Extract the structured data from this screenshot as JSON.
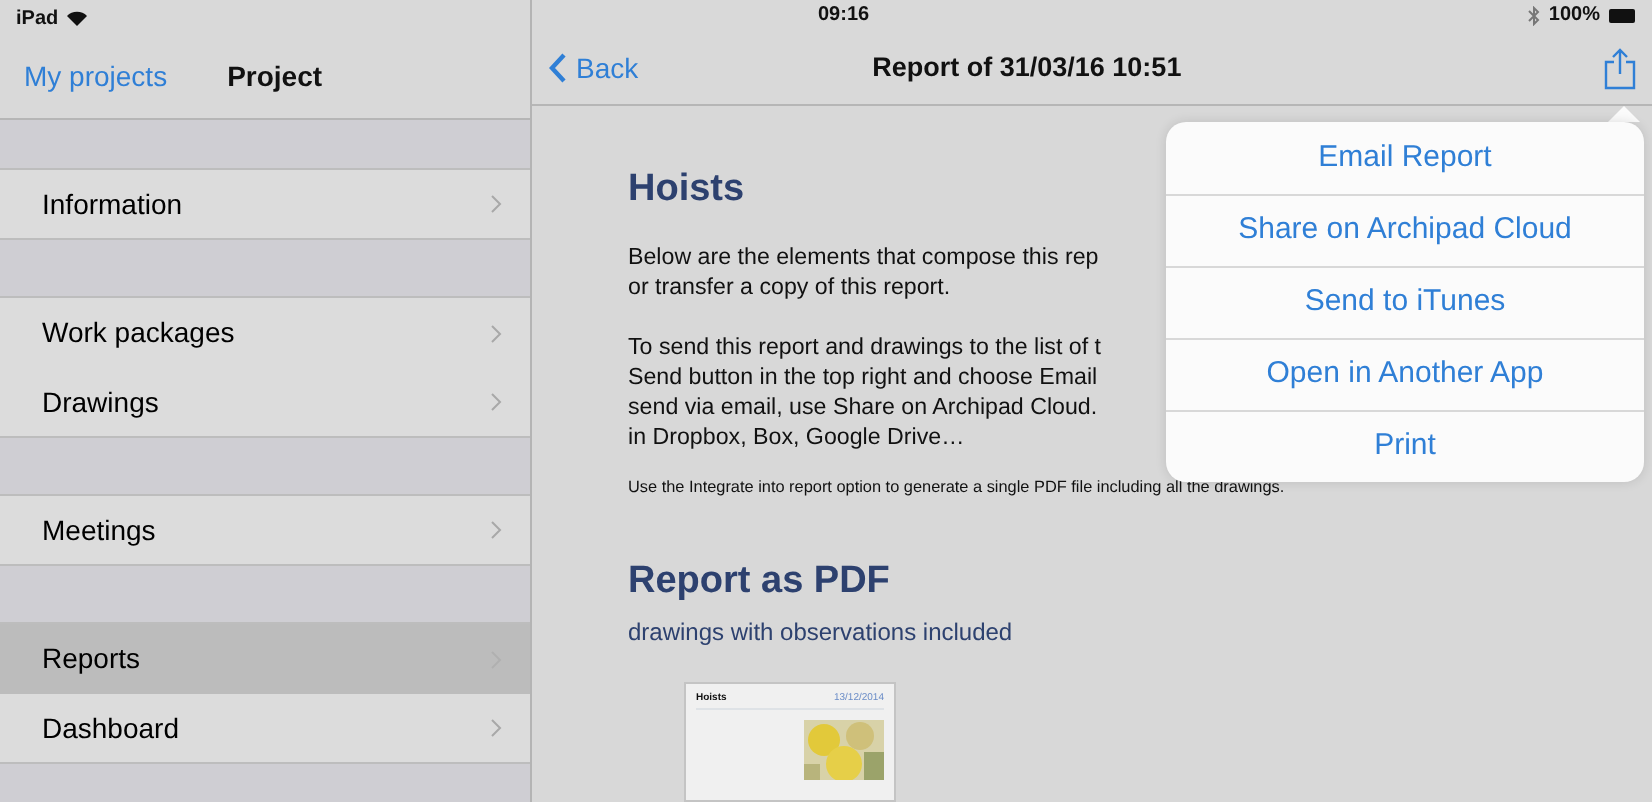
{
  "status_bar": {
    "device": "iPad",
    "time": "09:16",
    "battery": "100%"
  },
  "sidebar": {
    "back_link": "My projects",
    "title": "Project",
    "sections": [
      [
        {
          "label": "Information",
          "selected": false
        }
      ],
      [
        {
          "label": "Work packages",
          "selected": false
        },
        {
          "label": "Drawings",
          "selected": false
        }
      ],
      [
        {
          "label": "Meetings",
          "selected": false
        }
      ],
      [
        {
          "label": "Reports",
          "selected": true
        },
        {
          "label": "Dashboard",
          "selected": false
        }
      ]
    ]
  },
  "navigation": {
    "back": "Back",
    "title": "Report of 31/03/16 10:51"
  },
  "report": {
    "title": "Hoists",
    "paragraphs": [
      [
        "Below are the elements that compose this rep",
        "or transfer a copy of this report."
      ],
      [
        "To send this report and drawings to the list of t",
        "Send button in the top right and choose Email",
        "send via email, use Share on Archipad Cloud.",
        "in Dropbox, Box, Google Drive…"
      ]
    ],
    "note": "Use the Integrate into report option to generate a single PDF file including all the drawings.",
    "pdf_title": "Report as PDF",
    "pdf_subtitle": "drawings with observations included",
    "thumbnail": {
      "title": "Hoists",
      "date": "13/12/2014"
    }
  },
  "share_menu": [
    "Email Report",
    "Share on Archipad Cloud",
    "Send to iTunes",
    "Open in Another App",
    "Print"
  ]
}
